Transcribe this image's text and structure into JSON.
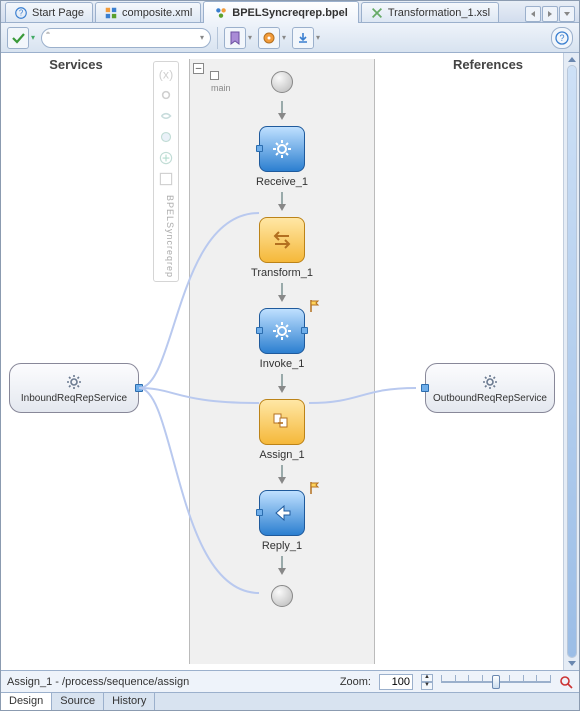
{
  "tabs": {
    "start": "Start Page",
    "composite": "composite.xml",
    "bpel": "BPELSyncreqrep.bpel",
    "transformation": "Transformation_1.xsl"
  },
  "columns": {
    "services": "Services",
    "references": "References"
  },
  "palette": {
    "process_label": "BPELSyncreqrep",
    "main": "main"
  },
  "nodes": {
    "receive": "Receive_1",
    "transform": "Transform_1",
    "invoke": "Invoke_1",
    "assign": "Assign_1",
    "reply": "Reply_1"
  },
  "services": {
    "inbound": "InboundReqRepService",
    "outbound": "OutboundReqRepService"
  },
  "status": {
    "selection": "Assign_1 - /process/sequence/assign",
    "zoom_label": "Zoom:",
    "zoom_value": "100"
  },
  "bottom_tabs": {
    "design": "Design",
    "source": "Source",
    "history": "History"
  }
}
